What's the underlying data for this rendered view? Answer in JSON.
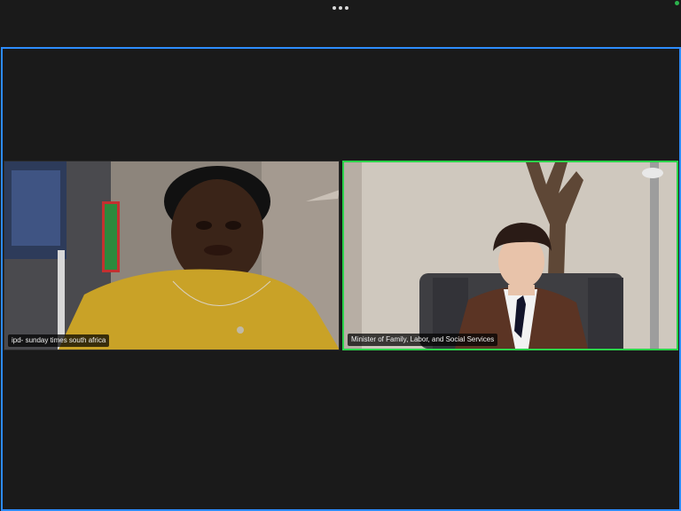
{
  "toolbar": {
    "more_icon": "more-horizontal-icon",
    "status_color": "#2bb24c"
  },
  "stage": {
    "active_border_color": "#2d8cff"
  },
  "participants": [
    {
      "label": "ipd- sunday times south africa",
      "speaking": false
    },
    {
      "label": "Minister of Family, Labor, and Social Services",
      "speaking": true,
      "highlight_color": "#2bd34a"
    }
  ]
}
